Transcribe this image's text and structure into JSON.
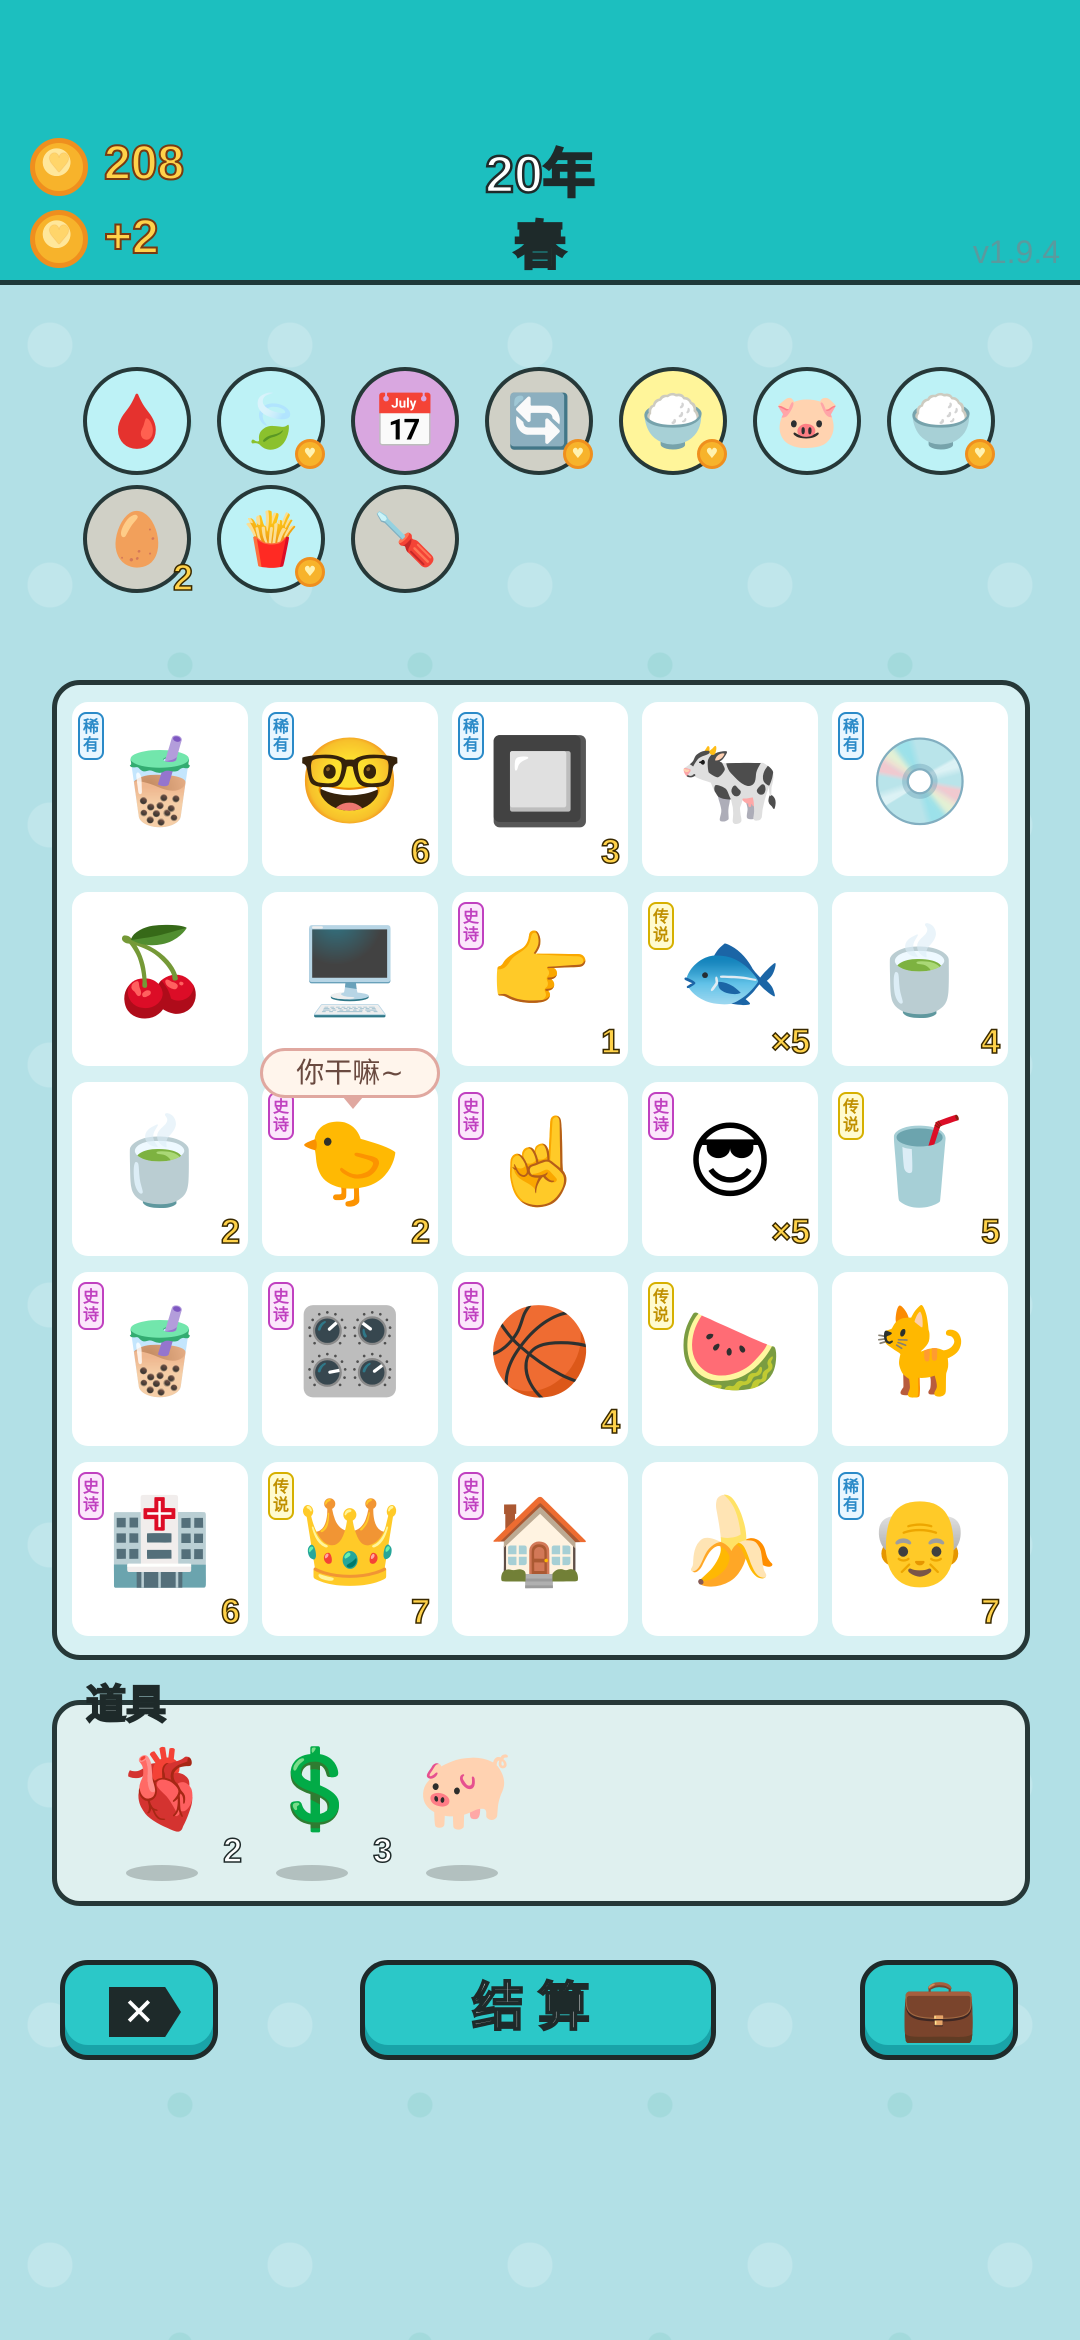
{
  "header": {
    "coins_total": "208",
    "coins_income": "+2",
    "year": "20年",
    "season": "春",
    "version": "v1.9.4"
  },
  "items": [
    {
      "name": "blood-bag",
      "icon": "🩸",
      "style": "",
      "heart": false,
      "count": ""
    },
    {
      "name": "leaf",
      "icon": "🍃",
      "style": "",
      "heart": true,
      "count": ""
    },
    {
      "name": "calendar",
      "icon": "📅",
      "style": "purple",
      "heart": false,
      "count": ""
    },
    {
      "name": "recycle",
      "icon": "🔄",
      "style": "gray",
      "heart": true,
      "count": ""
    },
    {
      "name": "rice-bowl",
      "icon": "🍚",
      "style": "yellow",
      "heart": true,
      "count": ""
    },
    {
      "name": "piggy",
      "icon": "🐷",
      "style": "",
      "heart": false,
      "count": ""
    },
    {
      "name": "rice-bowl-2",
      "icon": "🍚",
      "style": "",
      "heart": true,
      "count": ""
    },
    {
      "name": "egg-tray",
      "icon": "🥚",
      "style": "gray",
      "heart": false,
      "count": "2"
    },
    {
      "name": "fries",
      "icon": "🍟",
      "style": "",
      "heart": true,
      "count": ""
    },
    {
      "name": "screwdriver",
      "icon": "🪛",
      "style": "gray",
      "heart": false,
      "count": ""
    }
  ],
  "tags": {
    "rare": "稀有",
    "epic": "史诗",
    "legend": "传说"
  },
  "board": [
    {
      "icon": "🧋",
      "tag": "rare",
      "count": ""
    },
    {
      "icon": "🤓",
      "tag": "rare",
      "count": "6"
    },
    {
      "icon": "🔲",
      "tag": "rare",
      "count": "3"
    },
    {
      "icon": "🐄",
      "tag": "",
      "count": ""
    },
    {
      "icon": "💿",
      "tag": "rare",
      "count": ""
    },
    {
      "icon": "🍒",
      "tag": "",
      "count": ""
    },
    {
      "icon": "🖥️",
      "tag": "",
      "count": ""
    },
    {
      "icon": "👉",
      "tag": "epic",
      "count": "1"
    },
    {
      "icon": "🐟",
      "tag": "legend",
      "count": "×5"
    },
    {
      "icon": "🍵",
      "tag": "",
      "count": "4"
    },
    {
      "icon": "🍵",
      "tag": "",
      "count": "2"
    },
    {
      "icon": "🐤",
      "tag": "epic",
      "count": "2"
    },
    {
      "icon": "☝️",
      "tag": "epic",
      "count": ""
    },
    {
      "icon": "😎",
      "tag": "epic",
      "count": "×5"
    },
    {
      "icon": "🥤",
      "tag": "legend",
      "count": "5"
    },
    {
      "icon": "🧋",
      "tag": "epic",
      "count": ""
    },
    {
      "icon": "🎛️",
      "tag": "epic",
      "count": ""
    },
    {
      "icon": "🏀",
      "tag": "epic",
      "count": "4"
    },
    {
      "icon": "🍉",
      "tag": "legend",
      "count": ""
    },
    {
      "icon": "🐈",
      "tag": "",
      "count": ""
    },
    {
      "icon": "🏥",
      "tag": "epic",
      "count": "6"
    },
    {
      "icon": "👑",
      "tag": "legend",
      "count": "7"
    },
    {
      "icon": "🏠",
      "tag": "epic",
      "count": ""
    },
    {
      "icon": "🍌",
      "tag": "",
      "count": ""
    },
    {
      "icon": "👴",
      "tag": "rare",
      "count": "7"
    }
  ],
  "speech_bubble": "你干嘛~",
  "tools_title": "道具",
  "tools": [
    {
      "icon": "🫀",
      "count": "2"
    },
    {
      "icon": "💲",
      "count": "3"
    },
    {
      "icon": "🐖",
      "count": ""
    }
  ],
  "buttons": {
    "close": "✕",
    "settle": "结算",
    "bag": "💼"
  }
}
